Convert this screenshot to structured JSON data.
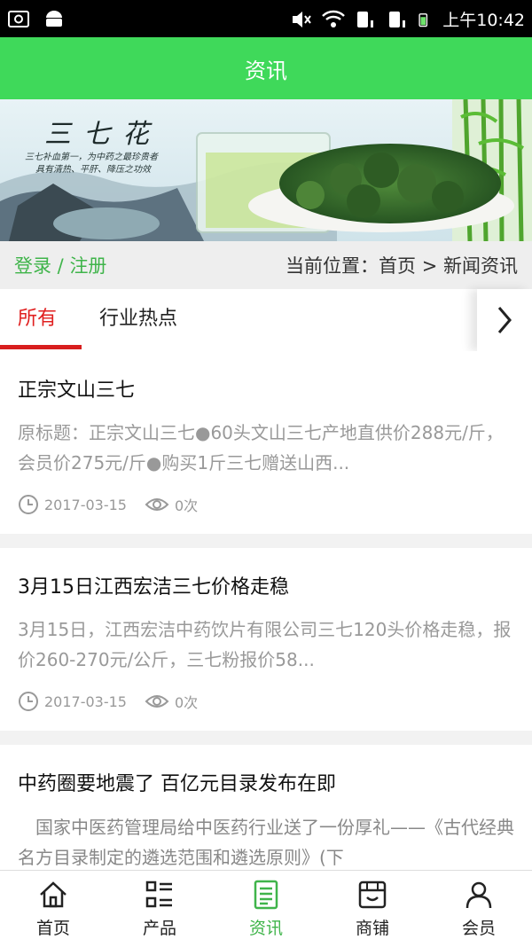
{
  "status_bar": {
    "time": "上午10:42"
  },
  "header": {
    "title": "资讯"
  },
  "banner": {
    "title": "三七花",
    "line1": "三七补血第一，为中药之最珍贵者",
    "line2": "具有清热、平肝、降压之功效"
  },
  "login": {
    "login": "登录",
    "sep": " / ",
    "register": "注册"
  },
  "breadcrumb": {
    "prefix": "当前位置：",
    "home": "首页",
    "arrow": " > ",
    "current": "新闻资讯"
  },
  "tabs": [
    {
      "label": "所有"
    },
    {
      "label": "行业热点"
    }
  ],
  "news": [
    {
      "title": "正宗文山三七",
      "summary": "原标题：正宗文山三七●60头文山三七产地直供价288元/斤，会员价275元/斤●购买1斤三七赠送山西...",
      "date": "2017-03-15",
      "views": "0次"
    },
    {
      "title": "3月15日江西宏洁三七价格走稳",
      "summary": "3月15日，江西宏洁中药饮片有限公司三七120头价格走稳，报价260-270元/公斤，三七粉报价58...",
      "date": "2017-03-15",
      "views": "0次"
    },
    {
      "title": "中药圈要地震了 百亿元目录发布在即",
      "summary": "　国家中医药管理局给中医药行业送了一份厚礼——《古代经典名方目录制定的遴选范围和遴选原则》(下",
      "date": "",
      "views": ""
    }
  ],
  "tabbar": [
    {
      "label": "首页",
      "icon": "home-icon"
    },
    {
      "label": "产品",
      "icon": "grid-list-icon"
    },
    {
      "label": "资讯",
      "icon": "document-icon"
    },
    {
      "label": "商铺",
      "icon": "store-icon"
    },
    {
      "label": "会员",
      "icon": "person-icon"
    }
  ],
  "colors": {
    "accent": "#3fd95a",
    "tab_active": "#e02020"
  }
}
